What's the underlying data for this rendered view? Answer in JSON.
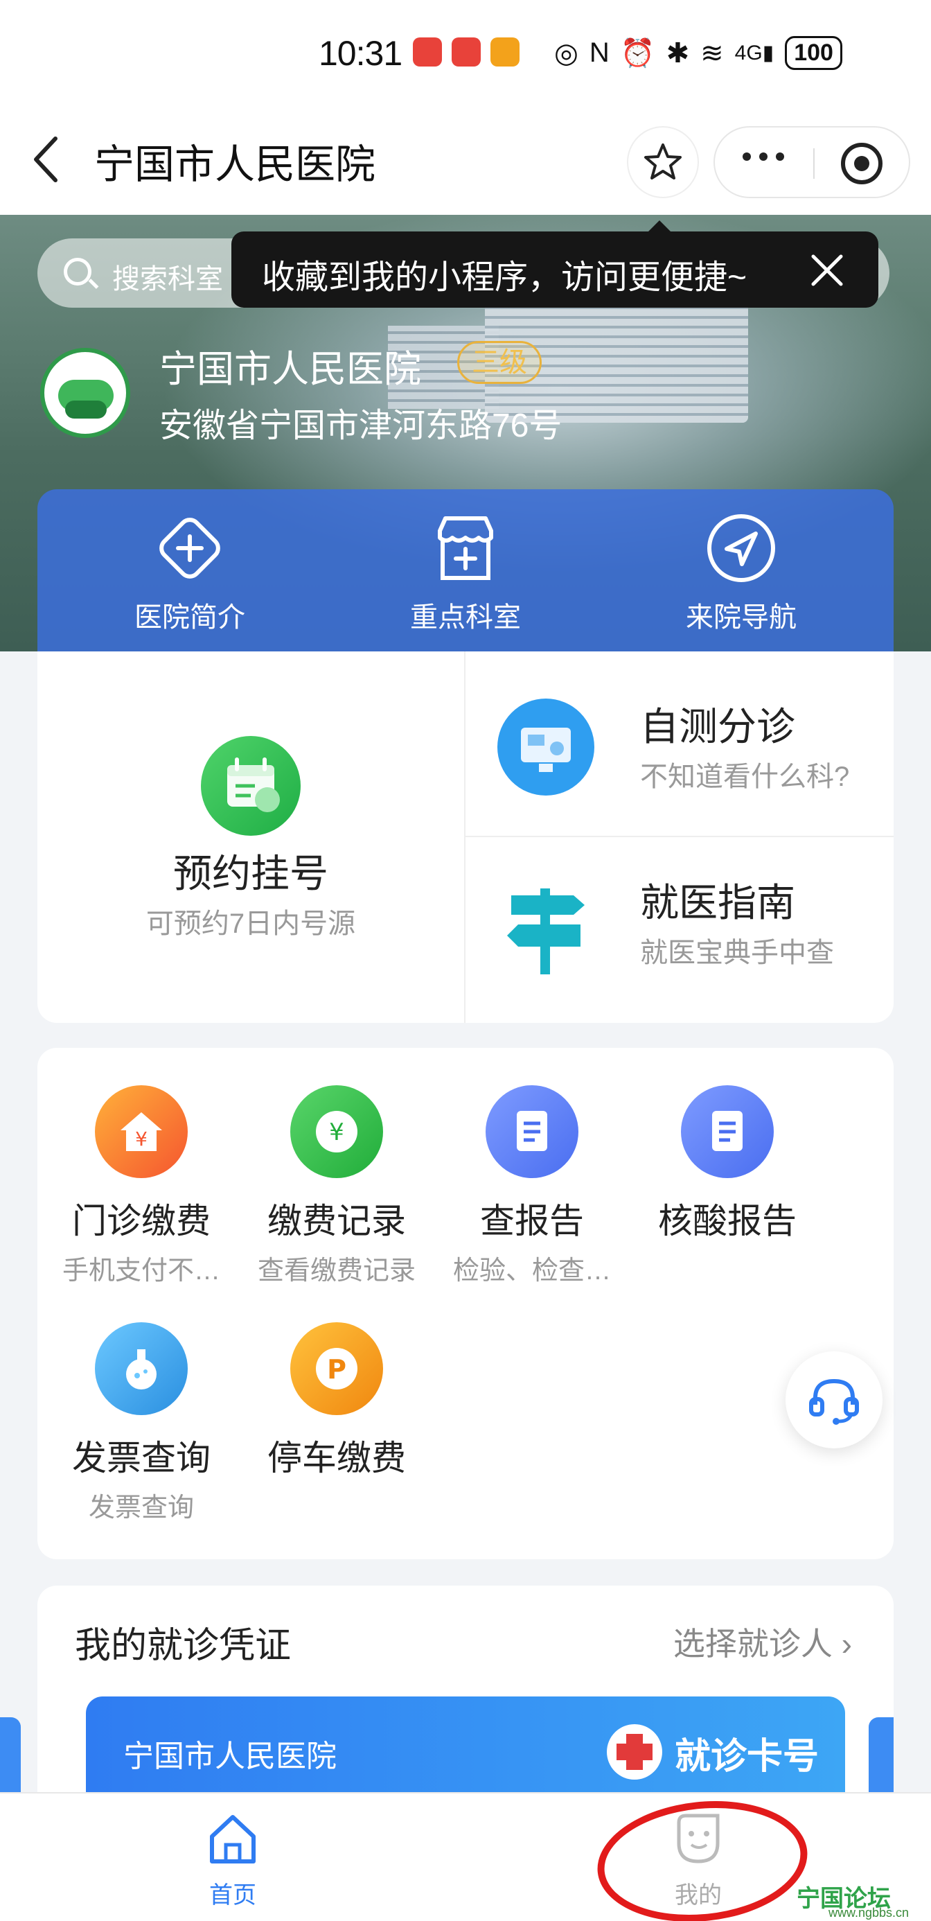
{
  "status_bar": {
    "time": "10:31",
    "network": "4G",
    "battery": "100"
  },
  "nav": {
    "title": "宁国市人民医院"
  },
  "search": {
    "placeholder": "搜索科室"
  },
  "tooltip": {
    "text": "收藏到我的小程序，访问更便捷~"
  },
  "hospital": {
    "name": "宁国市人民医院",
    "level": "三级",
    "address": "安徽省宁国市津河东路76号"
  },
  "quick_actions": [
    {
      "label": "医院简介",
      "icon": "plus-diamond-icon"
    },
    {
      "label": "重点科室",
      "icon": "store-icon"
    },
    {
      "label": "来院导航",
      "icon": "navigation-icon"
    }
  ],
  "registration": {
    "title": "预约挂号",
    "subtitle": "可预约7日内号源"
  },
  "features": [
    {
      "title": "自测分诊",
      "subtitle": "不知道看什么科?"
    },
    {
      "title": "就医指南",
      "subtitle": "就医宝典手中查"
    }
  ],
  "services": [
    {
      "title": "门诊缴费",
      "subtitle": "手机支付不…",
      "icon": "house-yen-icon",
      "color": "#f5552f"
    },
    {
      "title": "缴费记录",
      "subtitle": "查看缴费记录",
      "icon": "yen-coin-icon",
      "color": "#2dbb3f"
    },
    {
      "title": "查报告",
      "subtitle": "检验、检查…",
      "icon": "document-icon",
      "color": "#4f7cf0"
    },
    {
      "title": "核酸报告",
      "subtitle": "",
      "icon": "document-icon",
      "color": "#4f7cf0"
    },
    {
      "title": "发票查询",
      "subtitle": "发票查询",
      "icon": "flask-icon",
      "color": "#2e9ce8"
    },
    {
      "title": "停车缴费",
      "subtitle": "",
      "icon": "parking-icon",
      "color": "#f39a1a"
    }
  ],
  "credential": {
    "title": "我的就诊凭证",
    "link": "选择就诊人",
    "card_hospital": "宁国市人民医院",
    "card_label": "就诊卡号"
  },
  "tabs": [
    {
      "label": "首页",
      "active": true
    },
    {
      "label": "我的",
      "active": false
    }
  ],
  "watermark": {
    "text": "宁国论坛",
    "url": "www.ngbbs.cn"
  },
  "colors": {
    "accent": "#2f7cf2",
    "annotation": "#e21b1b"
  }
}
